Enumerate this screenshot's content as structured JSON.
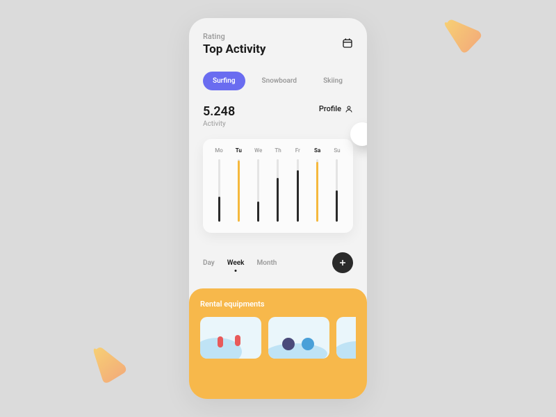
{
  "header": {
    "subtitle": "Rating",
    "title": "Top Activity"
  },
  "tabs": [
    {
      "label": "Surfing",
      "active": true
    },
    {
      "label": "Snowboard",
      "active": false
    },
    {
      "label": "Skiing",
      "active": false
    }
  ],
  "stats": {
    "value": "5.248",
    "label": "Activity",
    "profile_label": "Profile"
  },
  "chart_data": {
    "type": "bar",
    "categories": [
      "Mo",
      "Tu",
      "We",
      "Th",
      "Fr",
      "Sa",
      "Su"
    ],
    "highlighted": [
      "Tu",
      "Sa"
    ],
    "values": [
      40,
      98,
      32,
      70,
      82,
      96,
      50
    ],
    "colors": [
      "#2a2a2a",
      "#f5b83d",
      "#2a2a2a",
      "#2a2a2a",
      "#2a2a2a",
      "#f5b83d",
      "#2a2a2a"
    ],
    "ylim": [
      0,
      100
    ]
  },
  "periods": [
    {
      "label": "Day",
      "active": false
    },
    {
      "label": "Week",
      "active": true
    },
    {
      "label": "Month",
      "active": false
    }
  ],
  "rental": {
    "title": "Rental equipments"
  },
  "colors": {
    "accent": "#6a6cf0",
    "highlight": "#f5b83d",
    "panel": "#f7b84b"
  }
}
